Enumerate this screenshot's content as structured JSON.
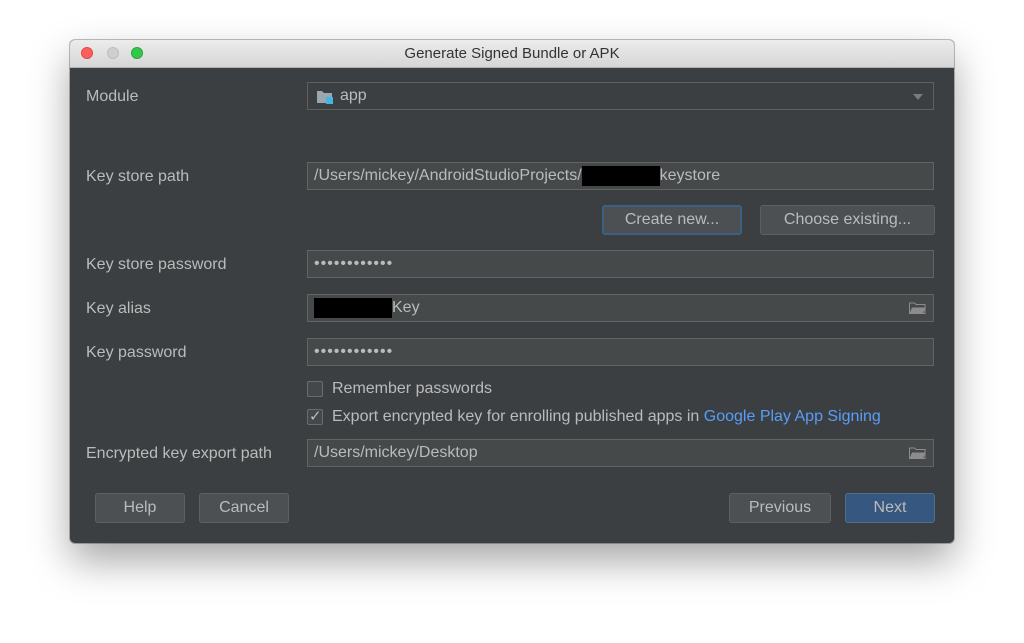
{
  "window": {
    "title": "Generate Signed Bundle or APK"
  },
  "module": {
    "label": "Module",
    "value": "app"
  },
  "keystore": {
    "label": "Key store path",
    "path_prefix": "/Users/mickey/AndroidStudioProjects/",
    "path_suffix": "keystore",
    "create_new": "Create new...",
    "choose_existing": "Choose existing..."
  },
  "keystore_password": {
    "label": "Key store password",
    "value": "••••••••••••"
  },
  "key_alias": {
    "label": "Key alias",
    "value_suffix": "Key"
  },
  "key_password": {
    "label": "Key password",
    "value": "••••••••••••"
  },
  "remember": {
    "label": "Remember passwords",
    "checked": false
  },
  "export": {
    "label": "Export encrypted key for enrolling published apps in",
    "link": "Google Play App Signing",
    "checked": true
  },
  "export_path": {
    "label": "Encrypted key export path",
    "value": "/Users/mickey/Desktop"
  },
  "buttons": {
    "help": "Help",
    "cancel": "Cancel",
    "previous": "Previous",
    "next": "Next"
  },
  "colors": {
    "dialog_bg": "#3c3f41",
    "field_bg": "#45494a",
    "text": "#bbbbbb",
    "link": "#589df6",
    "primary_button": "#365880"
  },
  "icons": {
    "module": "module-folder-icon",
    "dropdown": "chevron-down-icon",
    "browse": "folder-icon",
    "check": "checkmark-icon"
  }
}
